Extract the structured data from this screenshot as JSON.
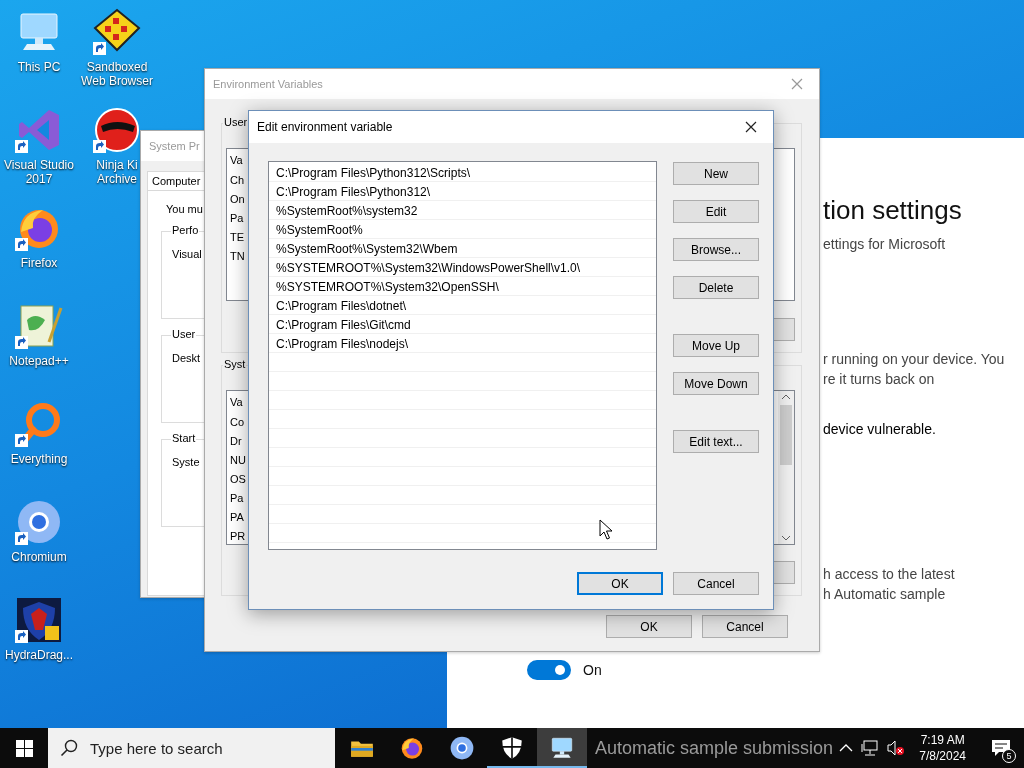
{
  "desktop": {
    "columns": [
      [
        {
          "label": "This PC",
          "kind": "monitor",
          "shortcut": false
        },
        {
          "label": "Visual Studio\n2017",
          "kind": "ribbon",
          "shortcut": true
        },
        {
          "label": "Firefox",
          "kind": "fox",
          "shortcut": true
        },
        {
          "label": "Notepad++",
          "kind": "notepad",
          "shortcut": true
        },
        {
          "label": "Everything",
          "kind": "ring",
          "shortcut": true
        },
        {
          "label": "Chromium",
          "kind": "orb",
          "shortcut": true
        },
        {
          "label": "HydraDrag...",
          "kind": "shield",
          "shortcut": true
        }
      ],
      [
        {
          "label": "Sandboxed\nWeb Browser",
          "kind": "diamond",
          "shortcut": true
        },
        {
          "label": "Ninja Ki\nArchive",
          "kind": "redcircle",
          "shortcut": true
        }
      ]
    ]
  },
  "settings_window": {
    "heading": "tion settings",
    "subtitle": "ettings for Microsoft",
    "paragraph_1": [
      "r running on your device. You",
      "re it turns back on"
    ],
    "warning": "device vulnerable.",
    "paragraph_2": [
      "h access to the latest",
      "h Automatic sample"
    ],
    "toggle": {
      "on": true,
      "label": "On"
    }
  },
  "system_properties": {
    "title": "System Pr",
    "tab": "Computer",
    "intro": "You mu",
    "groups": [
      {
        "legend": "Perfo",
        "text": "Visual"
      },
      {
        "legend": "User",
        "text": "Deskt"
      },
      {
        "legend": "Start",
        "text": "Syste"
      }
    ]
  },
  "environment_variables": {
    "title": "Environment Variables",
    "user_group": {
      "legend": "User",
      "header": "Va",
      "rows": [
        "Ch",
        "On",
        "Pa",
        "TE",
        "TN"
      ]
    },
    "system_group": {
      "legend": "Syst",
      "header": "Va",
      "rows": [
        "Co",
        "Dr",
        "NU",
        "OS",
        "Pa",
        "PA",
        "PR"
      ]
    },
    "buttons": [
      "OK",
      "Cancel"
    ]
  },
  "edit_dialog": {
    "title": "Edit environment variable",
    "entries": [
      "C:\\Program Files\\Python312\\Scripts\\",
      "C:\\Program Files\\Python312\\",
      "%SystemRoot%\\system32",
      "%SystemRoot%",
      "%SystemRoot%\\System32\\Wbem",
      "%SYSTEMROOT%\\System32\\WindowsPowerShell\\v1.0\\",
      "%SYSTEMROOT%\\System32\\OpenSSH\\",
      "C:\\Program Files\\dotnet\\",
      "C:\\Program Files\\Git\\cmd",
      "C:\\Program Files\\nodejs\\"
    ],
    "side_buttons": [
      [
        "New",
        "Edit",
        "Browse...",
        "Delete"
      ],
      [
        "Move Up",
        "Move Down"
      ],
      [
        "Edit text..."
      ]
    ],
    "buttons": [
      {
        "label": "OK",
        "default": true
      },
      {
        "label": "Cancel",
        "default": false
      }
    ]
  },
  "taskbar": {
    "search": {
      "placeholder": "Type here to search"
    },
    "apps": [
      {
        "kind": "folder",
        "running": false,
        "focused": false
      },
      {
        "kind": "fox",
        "running": false,
        "focused": false
      },
      {
        "kind": "orb",
        "running": false,
        "focused": false
      },
      {
        "kind": "shield",
        "running": true,
        "focused": false
      },
      {
        "kind": "monitor",
        "running": true,
        "focused": true
      }
    ],
    "overlay_text": "Automatic sample submission",
    "clock": {
      "time": "7:19 AM",
      "date": "7/8/2024"
    },
    "notifications": "5"
  }
}
